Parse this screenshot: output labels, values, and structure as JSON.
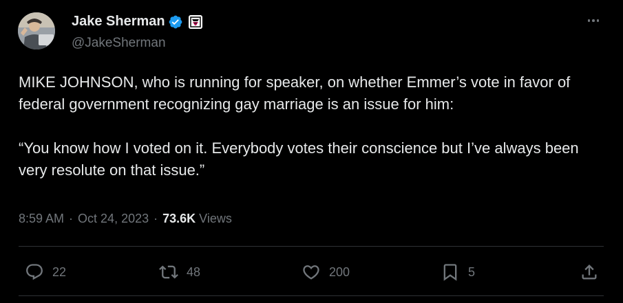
{
  "author": {
    "display_name": "Jake Sherman",
    "handle": "@JakeSherman"
  },
  "tweet": {
    "paragraphs": [
      "MIKE JOHNSON, who is running for speaker, on whether Emmer’s vote in favor of federal government recognizing gay marriage is an issue for him:",
      "“You know how I voted on it. Everybody votes their conscience but I’ve always been very resolute on that issue.”"
    ]
  },
  "meta": {
    "time": "8:59 AM",
    "separator": "·",
    "date": "Oct 24, 2023",
    "views_count": "73.6K",
    "views_label": "Views"
  },
  "actions": {
    "reply_count": "22",
    "repost_count": "48",
    "like_count": "200",
    "bookmark_count": "5"
  },
  "icons": {
    "verified": "verified-badge-icon",
    "affiliate": "affiliate-badge-icon",
    "more": "more-options-icon",
    "reply": "reply-icon",
    "repost": "repost-icon",
    "like": "heart-icon",
    "bookmark": "bookmark-icon",
    "share": "share-icon"
  },
  "colors": {
    "background": "#000000",
    "text": "#e7e9ea",
    "secondary_text": "#71767b",
    "verified": "#1d9bf0",
    "divider": "#2f3336"
  }
}
